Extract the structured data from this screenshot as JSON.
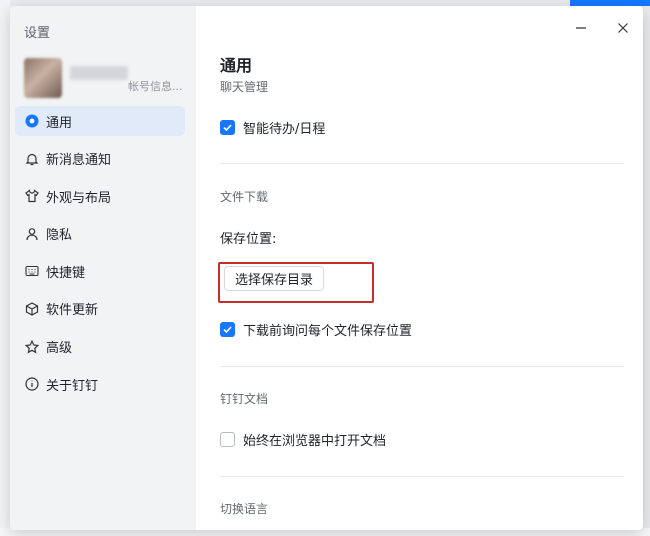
{
  "sidebar": {
    "title": "设置",
    "profile_sub": "帐号信息...",
    "items": [
      {
        "label": "通用",
        "icon": "general-dot-icon",
        "active": true
      },
      {
        "label": "新消息通知",
        "icon": "bell-icon"
      },
      {
        "label": "外观与布局",
        "icon": "shirt-icon"
      },
      {
        "label": "隐私",
        "icon": "person-icon"
      },
      {
        "label": "快捷键",
        "icon": "keyboard-icon"
      },
      {
        "label": "软件更新",
        "icon": "cube-icon"
      },
      {
        "label": "高级",
        "icon": "star-icon"
      },
      {
        "label": "关于钉钉",
        "icon": "info-icon"
      }
    ]
  },
  "content": {
    "title": "通用",
    "subtitle": "聊天管理",
    "smart_todo": "智能待办/日程",
    "download_group": "文件下载",
    "save_location_label": "保存位置:",
    "choose_dir_button": "选择保存目录",
    "ask_each_time": "下载前询问每个文件保存位置",
    "docs_group": "钉钉文档",
    "open_in_browser": "始终在浏览器中打开文档",
    "language_group": "切换语言"
  },
  "colors": {
    "accent": "#1677ff",
    "highlight_box": "#c62d2d",
    "sidebar_bg": "#f1f3f5",
    "active_bg": "#e1eaf8"
  },
  "checkboxes": {
    "smart_todo": true,
    "ask_each_time": true,
    "open_in_browser": false
  }
}
